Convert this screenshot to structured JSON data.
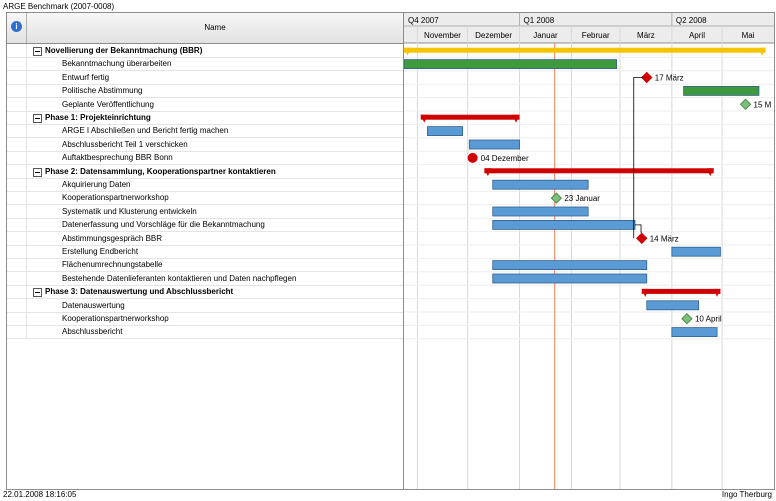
{
  "title": "ARGE Benchmark (2007-0008)",
  "header": {
    "name_label": "Name",
    "info_icon": "info-icon"
  },
  "footer": {
    "timestamp": "22.01.2008 18:16:05",
    "author": "Ingo Therburg"
  },
  "colors": {
    "summary_top": "#f5c400",
    "summary_phase": "#d10000",
    "task_bar": "#5b9bd5",
    "task_bar_green": "#3f9a3f",
    "milestone_red": "#d10000",
    "milestone_green": "#7cc07c",
    "today_line": "#f08060"
  },
  "chart_data": {
    "type": "gantt",
    "quarters": [
      "Q4 2007",
      "Q1 2008",
      "Q2 2008"
    ],
    "months": [
      "November",
      "Dezember",
      "Januar",
      "Februar",
      "März",
      "April",
      "Mai"
    ],
    "today": "2008-01-22",
    "tasks": [
      {
        "name": "Novellierung der Bekanntmachung (BBR)",
        "level": 0,
        "kind": "summary-top",
        "start": "2007-10-20",
        "end": "2008-05-27"
      },
      {
        "name": "Bekanntmachung überarbeiten",
        "level": 1,
        "kind": "bar-green",
        "start": "2007-10-20",
        "end": "2008-02-28"
      },
      {
        "name": "Entwurf fertig",
        "level": 1,
        "kind": "milestone-red",
        "date": "2008-03-17",
        "label": "17 März"
      },
      {
        "name": "Politische Abstimmung",
        "level": 1,
        "kind": "bar-green",
        "start": "2008-04-08",
        "end": "2008-05-23"
      },
      {
        "name": "Geplante Veröffentlichung",
        "level": 1,
        "kind": "milestone-green",
        "date": "2008-05-15",
        "label": "15 M"
      },
      {
        "name": "Phase 1: Projekteinrichtung",
        "level": 0,
        "kind": "summary",
        "start": "2007-11-03",
        "end": "2008-01-01"
      },
      {
        "name": "ARGE I Abschließen und Bericht fertig machen",
        "level": 1,
        "kind": "bar",
        "start": "2007-11-07",
        "end": "2007-11-28"
      },
      {
        "name": "Abschlussbericht Teil 1 verschicken",
        "level": 1,
        "kind": "bar",
        "start": "2007-12-02",
        "end": "2008-01-01"
      },
      {
        "name": "Auftaktbesprechung BBR Bonn",
        "level": 1,
        "kind": "milestone-red",
        "date": "2007-12-04",
        "label": "04 Dezember"
      },
      {
        "name": "Phase 2: Datensammlung, Kooperationspartner kontaktieren",
        "level": 0,
        "kind": "summary",
        "start": "2007-12-11",
        "end": "2008-04-26"
      },
      {
        "name": "Akquirierung Daten",
        "level": 1,
        "kind": "bar",
        "start": "2007-12-16",
        "end": "2008-02-11"
      },
      {
        "name": "Kooperationspartnerworkshop",
        "level": 1,
        "kind": "milestone-green",
        "date": "2008-01-23",
        "label": "23 Januar"
      },
      {
        "name": "Systematik und Klusterung entwickeln",
        "level": 1,
        "kind": "bar",
        "start": "2007-12-16",
        "end": "2008-02-11"
      },
      {
        "name": "Datenerfassung und Vorschläge für die Bekanntmachung",
        "level": 1,
        "kind": "bar",
        "start": "2007-12-16",
        "end": "2008-03-10"
      },
      {
        "name": "Abstimmungsgespräch BBR",
        "level": 1,
        "kind": "milestone-red",
        "date": "2008-03-14",
        "label": "14 März"
      },
      {
        "name": "Erstellung Endbericht",
        "level": 1,
        "kind": "bar",
        "start": "2008-04-01",
        "end": "2008-04-30"
      },
      {
        "name": "Flächenumrechnungstabelle",
        "level": 1,
        "kind": "bar",
        "start": "2007-12-16",
        "end": "2008-03-17"
      },
      {
        "name": "Bestehende Datenlieferanten kontaktieren und Daten nachpflegen",
        "level": 1,
        "kind": "bar",
        "start": "2007-12-16",
        "end": "2008-03-17"
      },
      {
        "name": "Phase 3: Datenauswertung und Abschlussbericht",
        "level": 0,
        "kind": "summary",
        "start": "2008-03-14",
        "end": "2008-04-30"
      },
      {
        "name": "Datenauswertung",
        "level": 1,
        "kind": "bar",
        "start": "2008-03-17",
        "end": "2008-04-17"
      },
      {
        "name": "Kooperationspartnerworkshop",
        "level": 1,
        "kind": "milestone-green",
        "date": "2008-04-10",
        "label": "10 April"
      },
      {
        "name": "Abschlussbericht",
        "level": 1,
        "kind": "bar",
        "start": "2008-04-01",
        "end": "2008-04-28"
      }
    ]
  }
}
